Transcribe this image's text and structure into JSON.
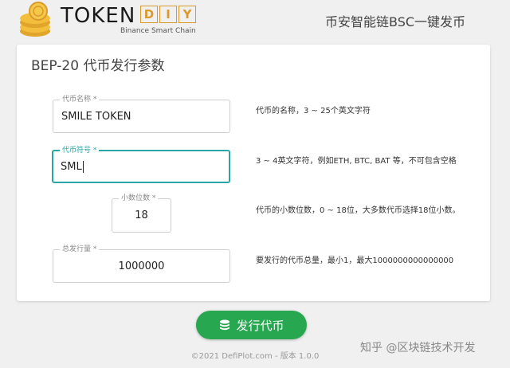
{
  "header": {
    "logo_token": "TOKEN",
    "logo_diy": [
      "D",
      "I",
      "Y"
    ],
    "logo_subtitle": "Binance Smart Chain",
    "title": "币安智能链BSC一键发币"
  },
  "card": {
    "title": "BEP-20 代币发行参数",
    "fields": [
      {
        "label": "代币名称 *",
        "value": "SMILE TOKEN",
        "help": "代币的名称，3 ~ 25个英文字符"
      },
      {
        "label": "代币符号 *",
        "value": "SML",
        "help": "3 ~ 4英文字符，例如ETH, BTC, BAT 等，不可包含空格"
      },
      {
        "label": "小数位数 *",
        "value": "18",
        "help": "代币的小数位数，0 ~ 18位，大多数代币选择18位小数。"
      },
      {
        "label": "总发行量 *",
        "value": "1000000",
        "help": "要发行的代币总量，最小1，最大1000000000000000"
      }
    ]
  },
  "action": {
    "issue_label": "发行代币"
  },
  "footer": {
    "text": "©2021 DefiPlot.com - 版本 1.0.0"
  },
  "watermark": {
    "text": "知乎 @区块链技术开发"
  },
  "colors": {
    "accent": "#2aa6a6",
    "button": "#27a850",
    "logo_gold": "#d99a2b"
  }
}
